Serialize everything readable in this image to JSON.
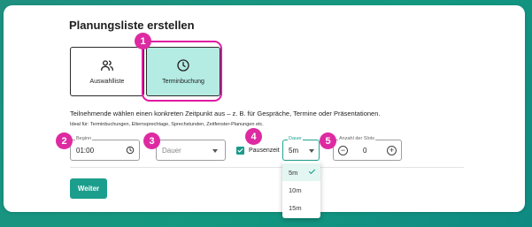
{
  "title": "Planungsliste erstellen",
  "options": [
    {
      "label": "Auswahlliste",
      "icon": "users-icon",
      "selected": false
    },
    {
      "label": "Terminbuchung",
      "icon": "clock-icon",
      "selected": true
    }
  ],
  "description": "Teilnehmende wählen einen konkreten Zeitpunkt aus – z. B. für Gespräche, Termine oder Präsentationen.",
  "ideal_for": "Ideal für: Terminbuchungen, Elternsprechtage, Sprechstunden, Zeitfenster-Planungen etc.",
  "fields": {
    "begin": {
      "label": "Beginn",
      "value": "01:00"
    },
    "dauer_main": {
      "placeholder": "Dauer"
    },
    "pause": {
      "label": "Pausenzeit",
      "checked": true
    },
    "dauer_pause": {
      "label": "Dauer",
      "value": "5m"
    },
    "slots": {
      "label": "Anzahl der Slots",
      "value": "0",
      "minus": "−",
      "plus": "+"
    }
  },
  "dropdown": {
    "options": [
      "5m",
      "10m",
      "15m"
    ],
    "selected": "5m"
  },
  "submit_label": "Weiter",
  "badges": [
    "1",
    "2",
    "3",
    "4",
    "5"
  ],
  "colors": {
    "accent": "#1c9e8d",
    "highlight": "#e01aa3",
    "selected_card": "#b4ebe2"
  }
}
